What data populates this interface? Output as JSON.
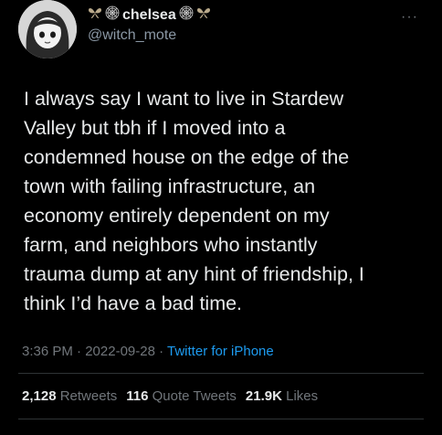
{
  "author": {
    "display_name": "chelsea",
    "handle": "@witch_mote",
    "name_decor_left": "butterfly-icon",
    "name_decor_left2": "spiderweb-icon",
    "name_decor_right": "spiderweb-icon",
    "name_decor_right2": "butterfly-icon"
  },
  "tweet": {
    "text": "I always say I want to live in Stardew\nValley but tbh if I moved into a\ncondemned house on the edge of the\ntown with failing infrastructure, an\neconomy entirely dependent on my\nfarm, and neighbors who instantly\ntrauma dump at any hint of friendship, I\nthink I’d have a bad time.",
    "time": "3:36 PM",
    "date": "2022-09-28",
    "source": "Twitter for iPhone",
    "separator": " · "
  },
  "stats": {
    "retweets_count": "2,128",
    "retweets_label": "Retweets",
    "quotes_count": "116",
    "quotes_label": "Quote Tweets",
    "likes_count": "21.9K",
    "likes_label": "Likes"
  },
  "more_glyph": "···",
  "colors": {
    "background": "#000000",
    "text": "#e7e9ea",
    "secondary": "#71767b",
    "link": "#1d9bf0"
  }
}
